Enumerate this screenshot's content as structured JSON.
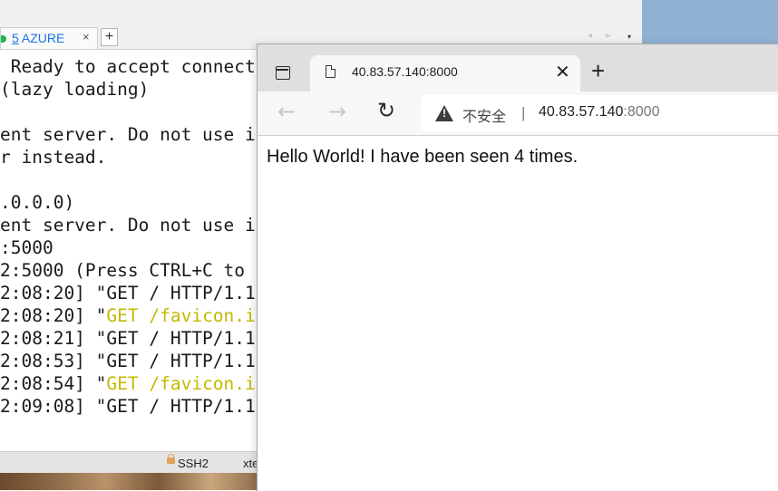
{
  "terminal": {
    "tab": {
      "number": "5",
      "name": "AZURE",
      "close": "×",
      "add": "+"
    },
    "tab_nav": "◂ ▸",
    "tab_menu": "▾",
    "lines": [
      {
        "plain": " Ready to accept connect"
      },
      {
        "plain": "(lazy loading)"
      },
      {
        "plain": ""
      },
      {
        "plain": "ent server. Do not use i"
      },
      {
        "plain": "r instead."
      },
      {
        "plain": ""
      },
      {
        "plain": ".0.0.0)"
      },
      {
        "plain": "ent server. Do not use i"
      },
      {
        "plain": ":5000"
      },
      {
        "plain": "2:5000 (Press CTRL+C to "
      },
      {
        "plain": "2:08:20] \"GET / HTTP/1.1"
      },
      {
        "pre": "2:08:20] \"",
        "hl": "GET /favicon.i"
      },
      {
        "plain": "2:08:21] \"GET / HTTP/1.1"
      },
      {
        "plain": "2:08:53] \"GET / HTTP/1.1"
      },
      {
        "pre": "2:08:54] \"",
        "hl": "GET /favicon.i"
      },
      {
        "plain": "2:09:08] \"GET / HTTP/1.1"
      }
    ],
    "status": {
      "protocol": "SSH2",
      "term_type": "xte"
    }
  },
  "browser": {
    "tab_title": "40.83.57.140:8000",
    "tab_close": "✕",
    "new_tab": "+",
    "security_label": "不安全",
    "separator": "|",
    "url_host": "40.83.57.140",
    "url_port": ":8000",
    "page_text": "Hello World! I have been seen 4 times."
  },
  "colors": {
    "highlight": "#c4b900",
    "tab_accent": "#1a73e8",
    "tab_dot": "#1fb54a"
  },
  "icons": [
    "sidebar-icon",
    "page-icon",
    "close-icon",
    "plus-icon",
    "back-arrow-icon",
    "forward-arrow-icon",
    "reload-icon",
    "warning-icon",
    "lock-icon"
  ]
}
